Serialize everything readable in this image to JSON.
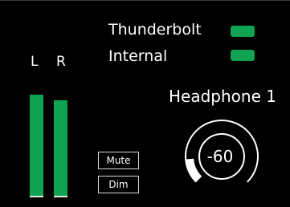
{
  "sources": [
    {
      "label": "Thunderbolt",
      "active": true
    },
    {
      "label": "Internal",
      "active": true
    }
  ],
  "meters": {
    "left_label": "L",
    "right_label": "R",
    "left_level": 0.78,
    "right_level": 0.74
  },
  "buttons": {
    "mute_label": "Mute",
    "dim_label": "Dim"
  },
  "output": {
    "label": "Headphone 1",
    "volume_value": "-60",
    "volume_fraction": 0.15
  },
  "colors": {
    "background": "#000000",
    "meter_green": "#0ea451",
    "led_green": "#0ea451",
    "foreground": "#ffffff"
  }
}
